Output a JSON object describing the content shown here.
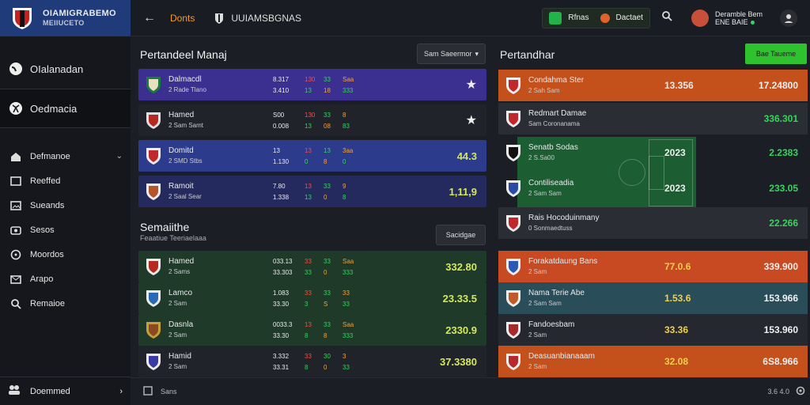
{
  "brand": {
    "title": "OIAMIGRABEMO",
    "subtitle": "MEIIUCETO"
  },
  "sidebar": {
    "main": [
      {
        "label": "OIalanadan",
        "icon": "globe-icon"
      },
      {
        "label": "Oedmacia",
        "icon": "soccer-ball-icon"
      }
    ],
    "sub": [
      {
        "label": "Defmanoe",
        "icon": "home-icon"
      },
      {
        "label": "Reeffed",
        "icon": "folder-icon"
      },
      {
        "label": "Sueands",
        "icon": "image-icon"
      },
      {
        "label": "Sesos",
        "icon": "camera-icon"
      },
      {
        "label": "Moordos",
        "icon": "clock-icon"
      },
      {
        "label": "Arapo",
        "icon": "mail-icon"
      },
      {
        "label": "Remaioe",
        "icon": "search-icon"
      }
    ],
    "footer": "Doemmed"
  },
  "topbar": {
    "active_tab": "Donts",
    "tab": "UUIAMSBGNAS",
    "btn1": "Rfnas",
    "btn2": "Dactaet",
    "user_name": "Deramble Bem",
    "user_sub": "ENE BAIE"
  },
  "left": {
    "title": "Pertandeel Manaj",
    "select": "Sam Saeermor",
    "rows": [
      {
        "name": "Dalmacdl",
        "sub": "2  Rade Tlano",
        "s1": "8.317",
        "s2": "3.410",
        "c1": "130",
        "c2": "33",
        "c3": "13",
        "c4": "18",
        "c5": "Saa",
        "c6": "333",
        "right": "★",
        "bg": "#3b2f8f"
      },
      {
        "name": "Hamed",
        "sub": "2  Sam Samt",
        "s1": "S00",
        "s2": "0.008",
        "c1": "130",
        "c2": "33",
        "c3": "13",
        "c4": "08",
        "c5": "8",
        "c6": "83",
        "right": "★",
        "bg": "#202329"
      },
      {
        "name": "Domitd",
        "sub": "2  SMD Stbs",
        "s1": "13",
        "s2": "1.130",
        "c1": "13",
        "c2": "13",
        "c3": "0",
        "c4": "8",
        "c5": "3aa",
        "c6": "0",
        "right": "44.3",
        "bg": "#2c3b8c"
      },
      {
        "name": "Ramoit",
        "sub": "2  Saal Sear",
        "s1": "7.80",
        "s2": "1.338",
        "c1": "13",
        "c2": "33",
        "c3": "13",
        "c4": "0",
        "c5": "9",
        "c6": "8",
        "right": "1,11,9",
        "bg": "#252a5e"
      }
    ],
    "title2": "Semaiithe",
    "sub2": "Feaatiue Teeriaelaaa",
    "select2": "Sacidgae",
    "rows2": [
      {
        "name": "Hamed",
        "sub": "2  Sams",
        "s1": "033.13",
        "s2": "33.303",
        "c1": "33",
        "c2": "33",
        "c3": "33",
        "c4": "0",
        "c5": "Saa",
        "c6": "333",
        "right": "332.80",
        "bg": "#1f3a28"
      },
      {
        "name": "Lamco",
        "sub": "2  Sam",
        "s1": "1.083",
        "s2": "33.30",
        "c1": "33",
        "c2": "33",
        "c3": "3",
        "c4": "S",
        "c5": "33",
        "c6": "33",
        "right": "23.33.5",
        "bg": "#1f3a28"
      },
      {
        "name": "Dasnla",
        "sub": "2  Sam",
        "s1": "0033.3",
        "s2": "33.30",
        "c1": "13",
        "c2": "33",
        "c3": "8",
        "c4": "8",
        "c5": "Saa",
        "c6": "333",
        "right": "2330.9",
        "bg": "#1f3a28"
      },
      {
        "name": "Hamid",
        "sub": "2  Sam",
        "s1": "3.332",
        "s2": "33.31",
        "c1": "33",
        "c2": "30",
        "c3": "8",
        "c4": "0",
        "c5": "3",
        "c6": "33",
        "right": "37.3380",
        "bg": "#202329"
      }
    ]
  },
  "right": {
    "title": "Pertandhar",
    "button": "Bae Taueme",
    "rows": [
      {
        "name": "Condahma Ster",
        "sub": "2  Sah Sam",
        "mid": "13.356",
        "val": "17.24800",
        "bg": "#c4501c"
      },
      {
        "name": "Redmart Damae",
        "sub": "Sam Coronanama",
        "mid": "",
        "val": "336.301",
        "bg": "#2a2d33"
      },
      {
        "name": "Senatb Sodas",
        "sub": "2  S.Sa00",
        "mid": "2023",
        "val": "2.2383",
        "bg": "#2a2d33"
      },
      {
        "name": "Contiliseadia",
        "sub": "2  Sam Sam",
        "mid": "2023",
        "val": "233.05",
        "bg": "#2a2d33"
      },
      {
        "name": "Rais Hocoduinmany",
        "sub": "0  Sonmaedtuss",
        "mid": "",
        "val": "22.266",
        "bg": "#2a2d33"
      },
      {
        "name": "Forakatdaung Bans",
        "sub": "2  Sam",
        "mid": "77.0.6",
        "val": "339.900",
        "bg": "#c74a22"
      },
      {
        "name": "Nama Terie Abe",
        "sub": "2  Sam Sam",
        "mid": "1.53.6",
        "val": "153.966",
        "bg": "#2a4d5a"
      },
      {
        "name": "Fandoesbam",
        "sub": "2  Sam",
        "mid": "33.36",
        "val": "153.960",
        "bg": "#25282e"
      },
      {
        "name": "Deasuanbianaaam",
        "sub": "2  Sam",
        "mid": "32.08",
        "val": "6S8.966",
        "bg": "#c4501c"
      }
    ]
  },
  "bottom": {
    "left": "Sans",
    "right": "3.6 4.0"
  }
}
